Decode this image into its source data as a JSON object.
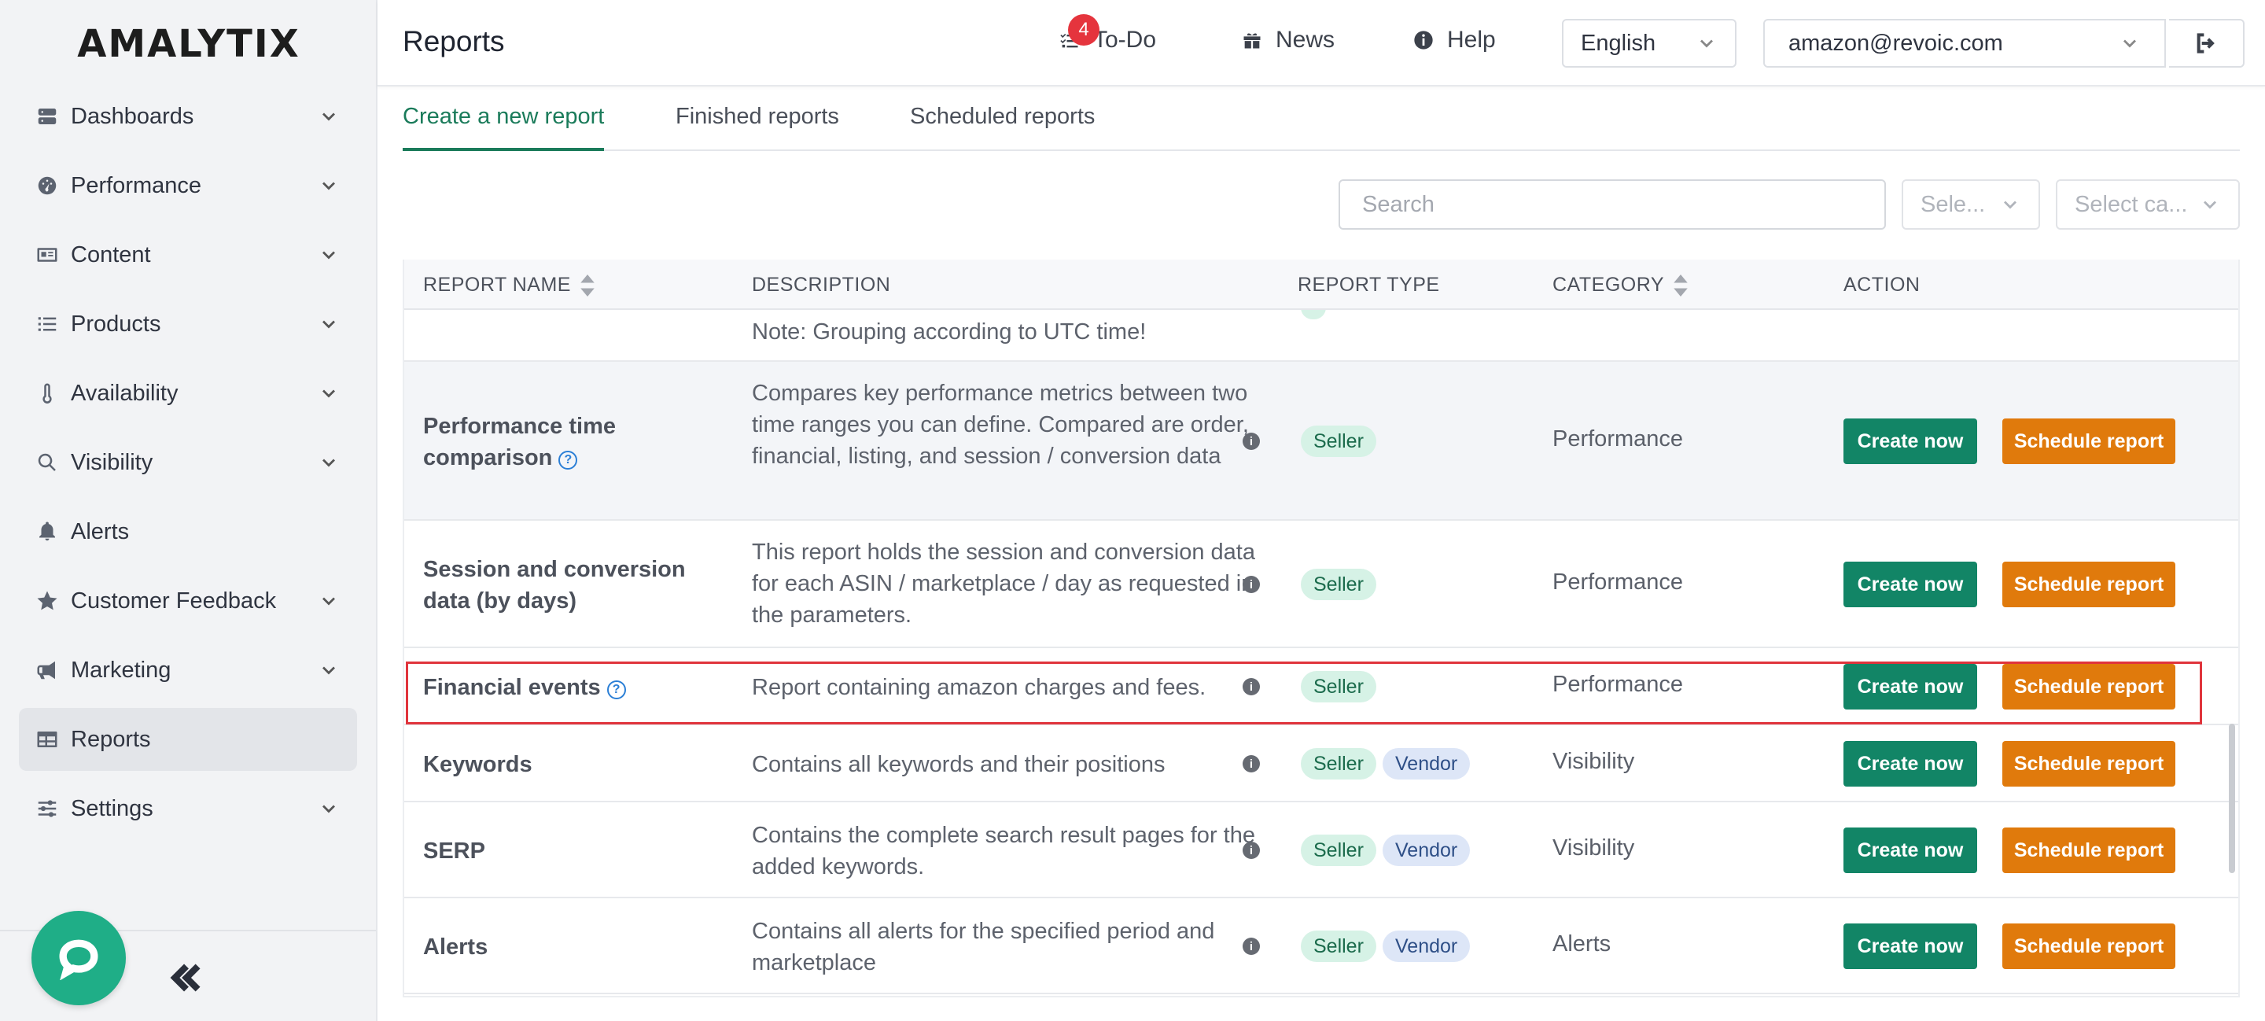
{
  "app": {
    "logo": "AMALYTIX",
    "page_title": "Reports"
  },
  "sidebar": {
    "items": [
      {
        "label": "Dashboards",
        "icon": "server-icon",
        "expandable": true
      },
      {
        "label": "Performance",
        "icon": "gauge-icon",
        "expandable": true
      },
      {
        "label": "Content",
        "icon": "id-card-icon",
        "expandable": true
      },
      {
        "label": "Products",
        "icon": "list-icon",
        "expandable": true
      },
      {
        "label": "Availability",
        "icon": "thermometer-icon",
        "expandable": true
      },
      {
        "label": "Visibility",
        "icon": "search-icon",
        "expandable": true
      },
      {
        "label": "Alerts",
        "icon": "bell-icon",
        "expandable": false
      },
      {
        "label": "Customer Feedback",
        "icon": "star-icon",
        "expandable": true
      },
      {
        "label": "Marketing",
        "icon": "megaphone-icon",
        "expandable": true
      },
      {
        "label": "Reports",
        "icon": "table-icon",
        "expandable": false,
        "active": true
      },
      {
        "label": "Settings",
        "icon": "sliders-icon",
        "expandable": true
      }
    ]
  },
  "header": {
    "todo_label": "To-Do",
    "todo_count": "4",
    "news_label": "News",
    "help_label": "Help",
    "language": "English",
    "account": "amazon@revoic.com"
  },
  "tabs": [
    {
      "label": "Create a new report",
      "active": true
    },
    {
      "label": "Finished reports",
      "active": false
    },
    {
      "label": "Scheduled reports",
      "active": false
    }
  ],
  "filters": {
    "search_placeholder": "Search",
    "type_placeholder": "Sele...",
    "category_placeholder": "Select ca..."
  },
  "table": {
    "columns": [
      "REPORT NAME",
      "DESCRIPTION",
      "REPORT TYPE",
      "CATEGORY",
      "ACTION"
    ],
    "partial_row_desc": "Note: Grouping according to UTC time!",
    "rows": [
      {
        "name": "Performance time comparison",
        "help": true,
        "desc": "Compares key performance metrics between two time ranges you can define. Compared are order, financial, listing, and session / conversion data",
        "types": [
          "Seller"
        ],
        "category": "Performance"
      },
      {
        "name": "Session and conversion data (by days)",
        "help": false,
        "desc": "This report holds the session and conversion data for each ASIN / marketplace / day as requested in the parameters.",
        "types": [
          "Seller"
        ],
        "category": "Performance"
      },
      {
        "name": "Financial events",
        "help": true,
        "desc": "Report containing amazon charges and fees.",
        "types": [
          "Seller"
        ],
        "category": "Performance"
      },
      {
        "name": "Keywords",
        "help": false,
        "desc": "Contains all keywords and their positions",
        "types": [
          "Seller",
          "Vendor"
        ],
        "category": "Visibility"
      },
      {
        "name": "SERP",
        "help": false,
        "desc": "Contains the complete search result pages for the added keywords.",
        "types": [
          "Seller",
          "Vendor"
        ],
        "category": "Visibility"
      },
      {
        "name": "Alerts",
        "help": false,
        "desc": "Contains all alerts for the specified period and marketplace",
        "types": [
          "Seller",
          "Vendor"
        ],
        "category": "Alerts"
      }
    ],
    "create_label": "Create now",
    "schedule_label": "Schedule report"
  },
  "colors": {
    "accent": "#1a7b5a",
    "create_button": "#128566",
    "schedule_button": "#e07a0c",
    "highlight": "#e0343c",
    "chat": "#1fae87"
  }
}
